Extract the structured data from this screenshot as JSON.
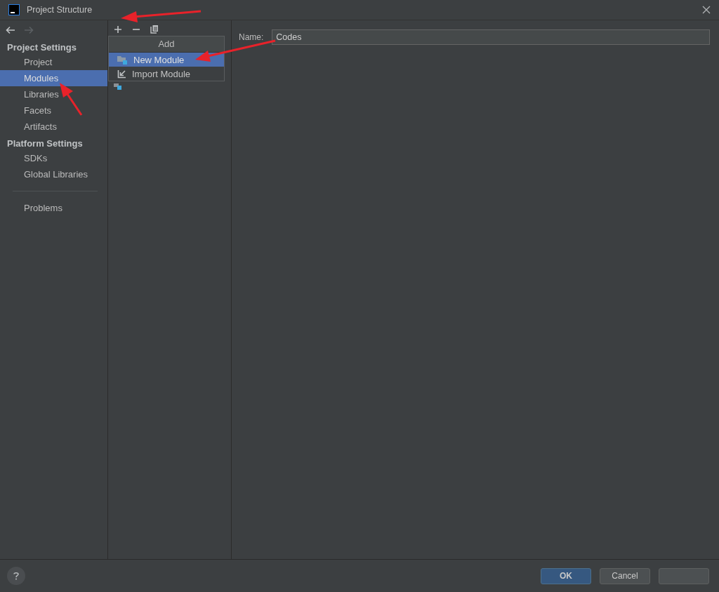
{
  "window": {
    "title": "Project Structure"
  },
  "sidebar": {
    "sections": [
      {
        "title": "Project Settings",
        "items": [
          {
            "label": "Project",
            "selected": false
          },
          {
            "label": "Modules",
            "selected": true
          },
          {
            "label": "Libraries",
            "selected": false
          },
          {
            "label": "Facets",
            "selected": false
          },
          {
            "label": "Artifacts",
            "selected": false
          }
        ]
      },
      {
        "title": "Platform Settings",
        "items": [
          {
            "label": "SDKs",
            "selected": false
          },
          {
            "label": "Global Libraries",
            "selected": false
          }
        ]
      }
    ],
    "footer_items": [
      {
        "label": "Problems",
        "selected": false
      }
    ]
  },
  "add_popup": {
    "title": "Add",
    "items": [
      {
        "label": "New Module",
        "selected": true,
        "kind": "new"
      },
      {
        "label": "Import Module",
        "selected": false,
        "kind": "import"
      }
    ]
  },
  "name_field": {
    "label": "Name:",
    "value": "Codes"
  },
  "buttons": [
    {
      "label": "OK",
      "kind": "primary"
    },
    {
      "label": "Cancel",
      "kind": "secondary"
    },
    {
      "kind": "secondary"
    }
  ]
}
